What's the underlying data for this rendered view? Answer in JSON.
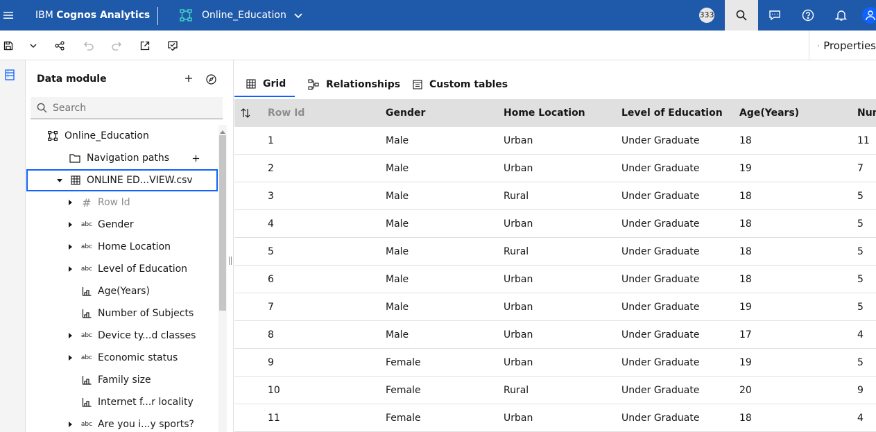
{
  "topbar": {
    "brand_prefix": "IBM",
    "brand_name": "Cognos Analytics",
    "module_name": "Online_Education",
    "notification_count": "333"
  },
  "toolbar": {
    "properties_label": "Properties"
  },
  "panel": {
    "title": "Data module",
    "search_placeholder": "Search",
    "root": "Online_Education",
    "navigation_paths": "Navigation paths",
    "table_name": "ONLINE ED...VIEW.csv",
    "fields": [
      {
        "label": "Row Id",
        "icon": "#"
      },
      {
        "label": "Gender",
        "icon": "abc"
      },
      {
        "label": "Home Location",
        "icon": "abc"
      },
      {
        "label": "Level of Education",
        "icon": "abc"
      },
      {
        "label": "Age(Years)",
        "icon": "measure-icon"
      },
      {
        "label": "Number of Subjects",
        "icon": "measure-icon"
      },
      {
        "label": "Device ty...d classes",
        "icon": "abc"
      },
      {
        "label": "Economic status",
        "icon": "abc"
      },
      {
        "label": "Family size",
        "icon": "measure-icon"
      },
      {
        "label": "Internet f...r locality",
        "icon": "measure-icon"
      },
      {
        "label": "Are you i...y sports?",
        "icon": "abc"
      }
    ]
  },
  "tabs": [
    "Grid",
    "Relationships",
    "Custom tables"
  ],
  "grid": {
    "columns": [
      "Row Id",
      "Gender",
      "Home Location",
      "Level of Education",
      "Age(Years)",
      "Num"
    ],
    "rows": [
      [
        "1",
        "Male",
        "Urban",
        "Under Graduate",
        "18",
        "11"
      ],
      [
        "2",
        "Male",
        "Urban",
        "Under Graduate",
        "19",
        "7"
      ],
      [
        "3",
        "Male",
        "Rural",
        "Under Graduate",
        "18",
        "5"
      ],
      [
        "4",
        "Male",
        "Urban",
        "Under Graduate",
        "18",
        "5"
      ],
      [
        "5",
        "Male",
        "Rural",
        "Under Graduate",
        "18",
        "5"
      ],
      [
        "6",
        "Male",
        "Urban",
        "Under Graduate",
        "18",
        "5"
      ],
      [
        "7",
        "Male",
        "Urban",
        "Under Graduate",
        "19",
        "5"
      ],
      [
        "8",
        "Male",
        "Urban",
        "Under Graduate",
        "17",
        "4"
      ],
      [
        "9",
        "Female",
        "Urban",
        "Under Graduate",
        "19",
        "5"
      ],
      [
        "10",
        "Female",
        "Rural",
        "Under Graduate",
        "20",
        "9"
      ],
      [
        "11",
        "Female",
        "Urban",
        "Under Graduate",
        "18",
        "4"
      ]
    ]
  },
  "colors": {
    "topbar": "#1f5aaa",
    "accent": "#0f62fe",
    "grid_header": "#e0e0e0"
  }
}
